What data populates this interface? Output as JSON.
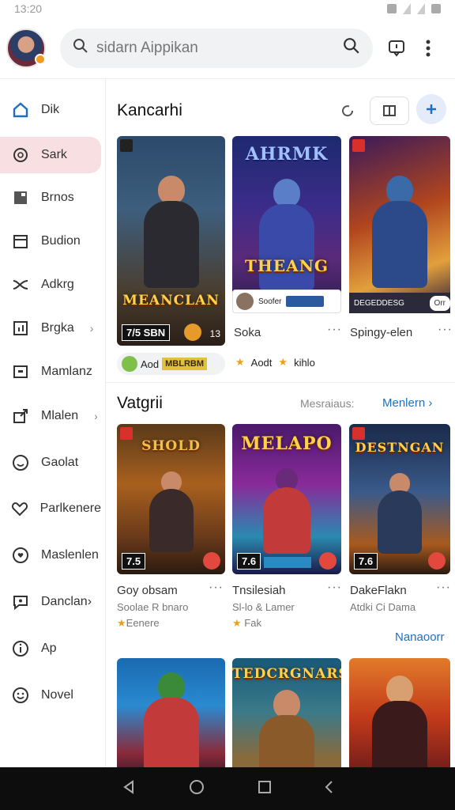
{
  "status": {
    "time": "13:20"
  },
  "search": {
    "placeholder": "sidarn Aippikan"
  },
  "sidebar": {
    "items": [
      {
        "label": "Dik",
        "icon": "home-icon",
        "active": false
      },
      {
        "label": "Sark",
        "icon": "search-icon",
        "active": true
      },
      {
        "label": "Brnos",
        "icon": "square-icon",
        "active": false
      },
      {
        "label": "Budion",
        "icon": "calendar-icon",
        "active": false
      },
      {
        "label": "Adkrg",
        "icon": "shuffle-icon",
        "active": false
      },
      {
        "label": "Brgka",
        "icon": "chart-icon",
        "active": false,
        "chevron": "›"
      },
      {
        "label": "Mamlanz",
        "icon": "tv-icon",
        "active": false
      },
      {
        "label": "Mlalen",
        "icon": "share-icon",
        "active": false,
        "chevron": "›"
      },
      {
        "label": "Gaolat",
        "icon": "face-icon",
        "active": false
      },
      {
        "label": "Parlkenere",
        "icon": "heart-icon",
        "active": false
      },
      {
        "label": "Maslenlen",
        "icon": "chat-heart-icon",
        "active": false
      },
      {
        "label": "Danclan›",
        "icon": "message-icon",
        "active": false
      },
      {
        "label": "Ap",
        "icon": "info-icon",
        "active": false
      },
      {
        "label": "Novel",
        "icon": "smile-icon",
        "active": false
      }
    ]
  },
  "section1": {
    "title": "Kancarhi",
    "cards": [
      {
        "art_title": "MEANCLAN",
        "num": "7/5 SBN",
        "extra": "13",
        "name": "",
        "sub": ""
      },
      {
        "art_title": "THEANG",
        "header": "AHRMK",
        "name": "Soka",
        "sub": "Soofer"
      },
      {
        "art_title": "",
        "name": "Spingy-elen",
        "sub": "DEGEDDESG"
      }
    ],
    "chip1": {
      "label": "Aod",
      "sub": "MBLRBM"
    },
    "chip2": {
      "a": "Aodt",
      "b": "kihlo"
    },
    "chip2_partial": "Orr"
  },
  "section2": {
    "title": "Vatgrii",
    "filter_label": "Mesraiaus:",
    "link_label": "Menlern ›",
    "more_link": "Nanaoorr",
    "cards": [
      {
        "art_title": "SHOLD",
        "num": "7.5",
        "name": "Goy obsam",
        "sub": "Soolae R bnaro",
        "meta": "Eenere",
        "rating": ""
      },
      {
        "art_title": "MELAPO",
        "num": "7.6",
        "name": "Tnsilesiah",
        "sub": "Sl-lo & Lamer",
        "meta": "Fak",
        "rating": ""
      },
      {
        "art_title": "DESTNGAN",
        "num": "7.6",
        "name": "DakeFlakn",
        "sub": "Atdki Ci Dama",
        "meta": "",
        "rating": ""
      }
    ]
  },
  "section3": {
    "cards": [
      {
        "art_title": ""
      },
      {
        "art_title": "TEDCRGNARS"
      },
      {
        "art_title": ""
      }
    ]
  },
  "colors": {
    "accent": "#1e6fc2",
    "active_bg": "#f8dfe2"
  }
}
